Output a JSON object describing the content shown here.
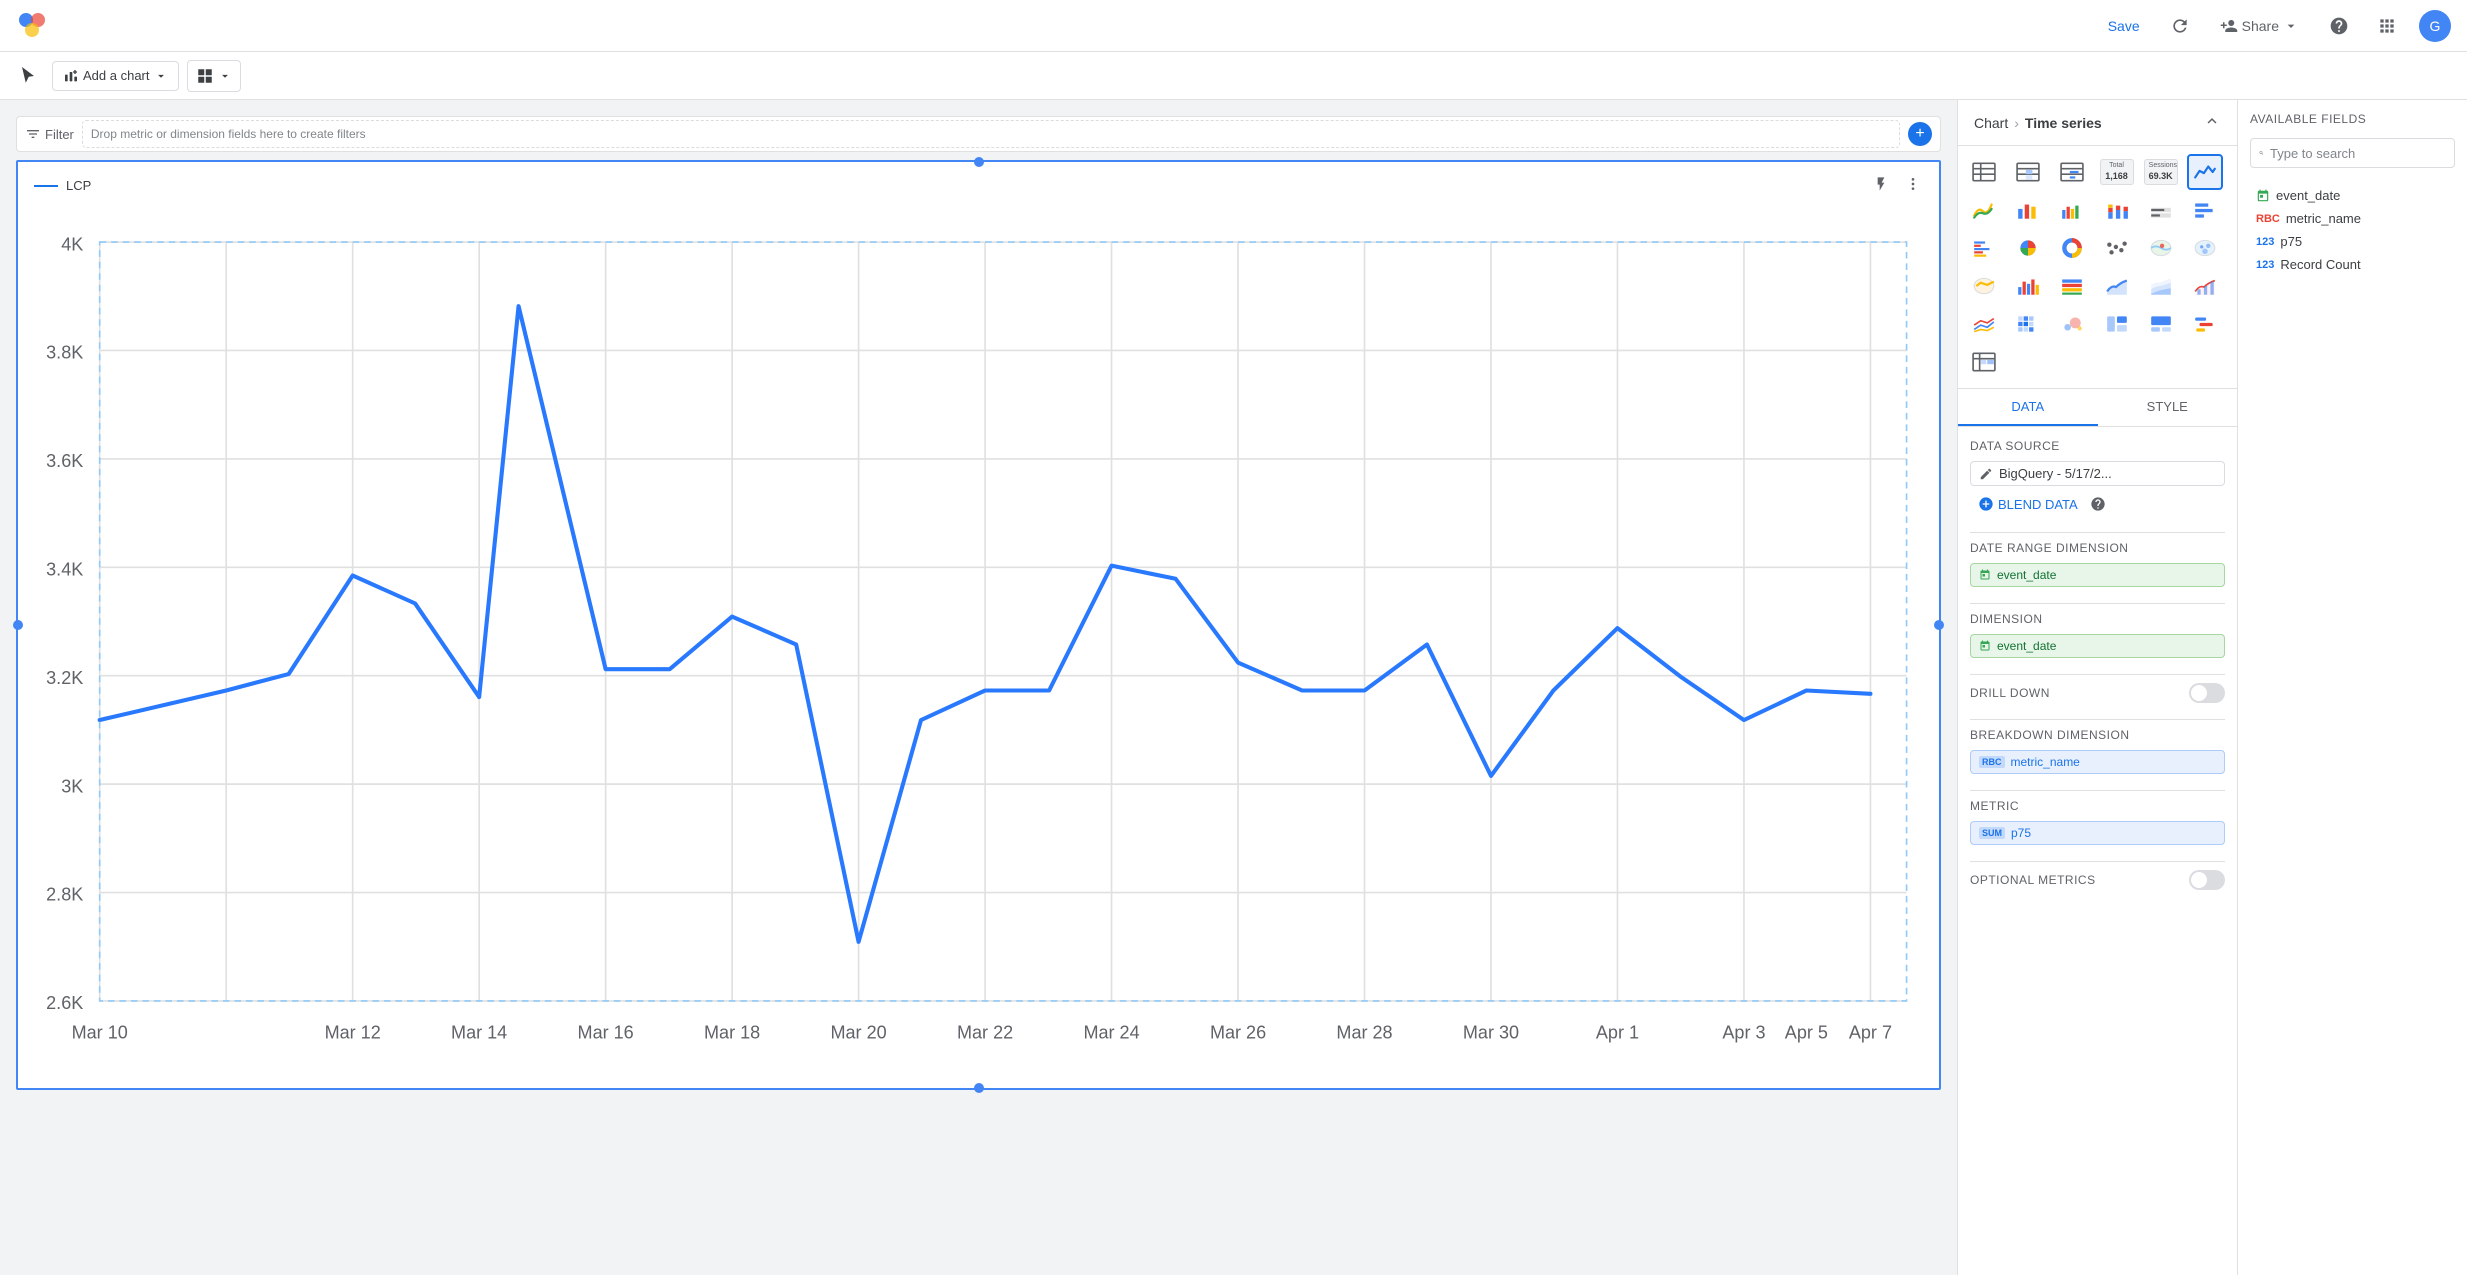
{
  "topNav": {
    "saveLabel": "Save",
    "shareLabel": "Share",
    "logoAlt": "Looker Studio"
  },
  "toolbar": {
    "addChartLabel": "Add a chart",
    "moreOptionsLabel": ""
  },
  "filterBar": {
    "filterLabel": "Filter",
    "dropZoneText": "Drop metric or dimension fields here to create filters"
  },
  "panel": {
    "breadcrumb1": "Chart",
    "breadcrumb2": "Time series",
    "tabs": [
      "DATA",
      "STYLE"
    ],
    "activeTab": "DATA",
    "dataSources": {
      "title": "Data source",
      "source": "BigQuery - 5/17/2...",
      "blendLabel": "BLEND DATA"
    },
    "dateRange": {
      "title": "Date Range Dimension",
      "field": "event_date"
    },
    "dimension": {
      "title": "Dimension",
      "field": "event_date"
    },
    "drillDown": {
      "title": "Drill down",
      "enabled": false
    },
    "breakdownDimension": {
      "title": "Breakdown Dimension",
      "field": "metric_name"
    },
    "metric": {
      "title": "Metric",
      "agg": "SUM",
      "field": "p75"
    },
    "optionalMetrics": {
      "title": "Optional metrics",
      "enabled": false
    },
    "availableFields": {
      "title": "Available Fields",
      "searchPlaceholder": "Type to search",
      "fields": [
        {
          "name": "event_date",
          "type": "date"
        },
        {
          "name": "metric_name",
          "type": "text"
        },
        {
          "name": "p75",
          "type": "num"
        },
        {
          "name": "Record Count",
          "type": "num"
        }
      ]
    }
  },
  "chart": {
    "legendLabel": "LCP",
    "yAxis": [
      "4K",
      "3.8K",
      "3.6K",
      "3.4K",
      "3.2K",
      "3K",
      "2.8K",
      "2.6K"
    ],
    "xAxis": [
      "Mar 10",
      "Mar 12",
      "Mar 14",
      "Mar 16",
      "Mar 18",
      "Mar 20",
      "Mar 22",
      "Mar 24",
      "Mar 26",
      "Mar 28",
      "Mar 30",
      "Apr 1",
      "Apr 3",
      "Apr 5",
      "Apr 7"
    ],
    "chartTypes": [
      {
        "id": "table1",
        "label": "Table"
      },
      {
        "id": "table2",
        "label": "Table heatmap"
      },
      {
        "id": "table3",
        "label": "Table bar"
      },
      {
        "id": "scorecard1",
        "label": "Scorecard total",
        "badge1": "Total",
        "badge2": "1,168"
      },
      {
        "id": "scorecard2",
        "label": "Scorecard sessions",
        "badge1": "Sessions",
        "badge2": "69.3K"
      },
      {
        "id": "timeseries",
        "label": "Time series",
        "active": true
      },
      {
        "id": "smoothline",
        "label": "Smooth line"
      },
      {
        "id": "line",
        "label": "Line"
      },
      {
        "id": "bar",
        "label": "Bar"
      },
      {
        "id": "multibar",
        "label": "Multi bar"
      },
      {
        "id": "stackedbar",
        "label": "Stacked bar"
      },
      {
        "id": "bullet",
        "label": "Bullet"
      },
      {
        "id": "hbar1",
        "label": "Horizontal bar 1"
      },
      {
        "id": "hbar2",
        "label": "Horizontal bar 2"
      },
      {
        "id": "pie",
        "label": "Pie"
      },
      {
        "id": "donut",
        "label": "Donut"
      },
      {
        "id": "scatter",
        "label": "Scatter"
      },
      {
        "id": "map1",
        "label": "Map 1"
      },
      {
        "id": "map2",
        "label": "Map 2"
      },
      {
        "id": "map3",
        "label": "Map 3"
      },
      {
        "id": "multibar2",
        "label": "Multi bar 2"
      },
      {
        "id": "stackedbar2",
        "label": "Stacked bar 2"
      },
      {
        "id": "arealine",
        "label": "Area line"
      },
      {
        "id": "stackedarea",
        "label": "Stacked area"
      },
      {
        "id": "areabar",
        "label": "Area bar"
      },
      {
        "id": "multiline",
        "label": "Multi line"
      },
      {
        "id": "heatmap",
        "label": "Heatmap"
      },
      {
        "id": "bubble",
        "label": "Bubble"
      },
      {
        "id": "treedt1",
        "label": "Tree 1"
      },
      {
        "id": "treedt2",
        "label": "Tree 2"
      },
      {
        "id": "gantt",
        "label": "Gantt"
      },
      {
        "id": "pivot",
        "label": "Pivot"
      }
    ]
  },
  "colors": {
    "accent": "#1a73e8",
    "border": "#dadce0",
    "text": "#3c4043",
    "muted": "#5f6368",
    "lineColor": "#2979ff"
  }
}
